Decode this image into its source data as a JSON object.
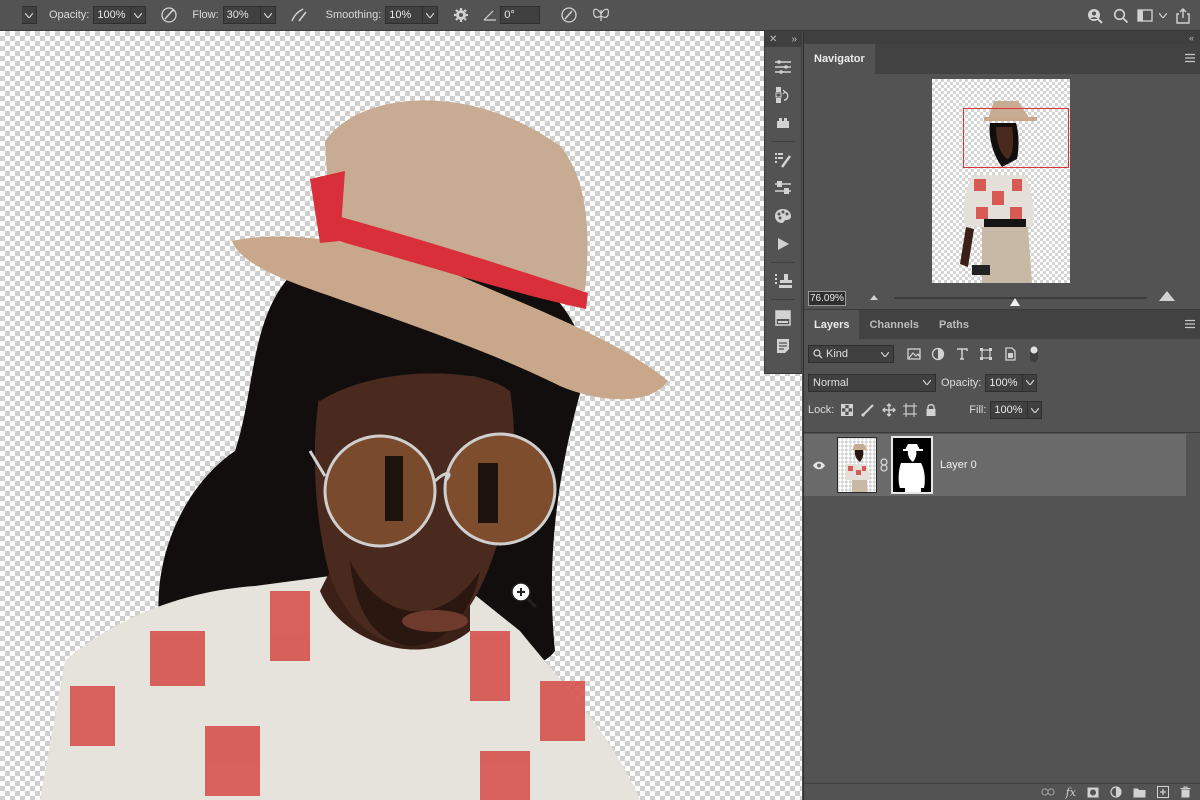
{
  "options_bar": {
    "opacity_label": "Opacity:",
    "opacity_value": "100%",
    "flow_label": "Flow:",
    "flow_value": "30%",
    "smoothing_label": "Smoothing:",
    "smoothing_value": "10%",
    "angle_value": "0°"
  },
  "navigator": {
    "tab": "Navigator",
    "zoom_value": "76.09%"
  },
  "layers_panel": {
    "tabs": [
      "Layers",
      "Channels",
      "Paths"
    ],
    "filter_kind": "Kind",
    "blend_mode": "Normal",
    "opacity_label": "Opacity:",
    "opacity_value": "100%",
    "lock_label": "Lock:",
    "fill_label": "Fill:",
    "fill_value": "100%",
    "layers": [
      {
        "name": "Layer 0"
      }
    ]
  },
  "colors": {
    "ui_background": "#535353",
    "panel_dark": "#424242",
    "selected_layer": "#6a6a6a",
    "navigator_box": "#e0323a"
  },
  "icons": {
    "options_bar": [
      "airbrush-pressure-icon",
      "pen-pressure-icon",
      "settings-gear-icon",
      "angle-icon",
      "pressure-size-icon",
      "symmetry-butterfly-icon"
    ],
    "top_right": [
      "user-search-icon",
      "search-icon",
      "workspace-icon",
      "share-icon"
    ],
    "dock": [
      "adjustments-icon",
      "history-icon",
      "libraries-icon",
      "brush-settings-icon",
      "tool-presets-icon",
      "color-swatches-icon",
      "actions-play-icon",
      "clone-source-icon",
      "layer-comps-icon",
      "notes-icon"
    ],
    "panel_bottom": [
      "link-layers-icon",
      "fx-icon",
      "add-mask-icon",
      "adjustment-layer-icon",
      "group-folder-icon",
      "new-layer-icon",
      "delete-trash-icon"
    ]
  }
}
